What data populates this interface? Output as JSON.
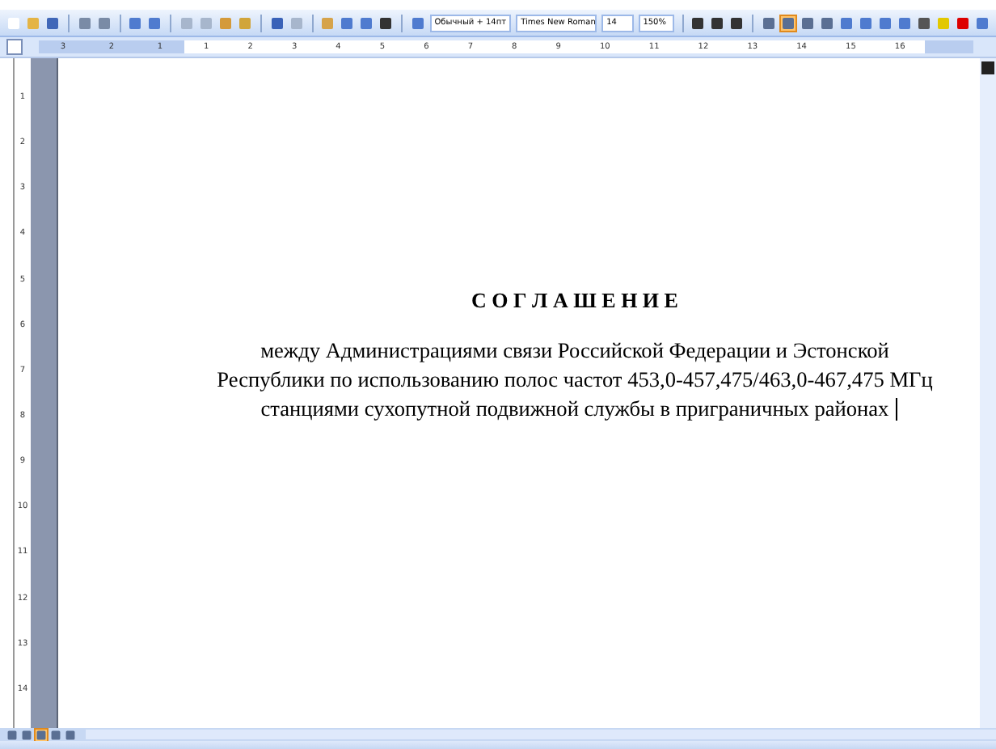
{
  "toolbar": {
    "style": "Обычный + 14пт",
    "font": "Times New Roman",
    "size": "14",
    "zoom": "150%",
    "alignment": [
      {
        "selected": false
      },
      {
        "selected": true
      },
      {
        "selected": false
      },
      {
        "selected": false
      }
    ]
  },
  "ruler": {
    "left_labels": [
      "3",
      "2",
      "1"
    ],
    "labels": [
      "1",
      "2",
      "3",
      "4",
      "5",
      "6",
      "7",
      "8",
      "9",
      "10",
      "11",
      "12",
      "13",
      "14",
      "15",
      "16"
    ]
  },
  "vertical_ruler": {
    "labels": [
      "1",
      "2",
      "3",
      "4",
      "5",
      "6",
      "7",
      "8",
      "9",
      "10",
      "11",
      "12",
      "13",
      "14"
    ]
  },
  "document": {
    "title": "С О Г Л А Ш Е Н И Е",
    "lines": [
      "между Администрациями связи Российской Федерации и Эстонской",
      "Республики по использованию полос частот 453,0-457,475/463,0-467,475 МГц",
      "станциями сухопутной подвижной службы в приграничных районах"
    ]
  },
  "view_buttons": [
    {
      "selected": false
    },
    {
      "selected": false
    },
    {
      "selected": true
    },
    {
      "selected": false
    },
    {
      "selected": false
    }
  ]
}
